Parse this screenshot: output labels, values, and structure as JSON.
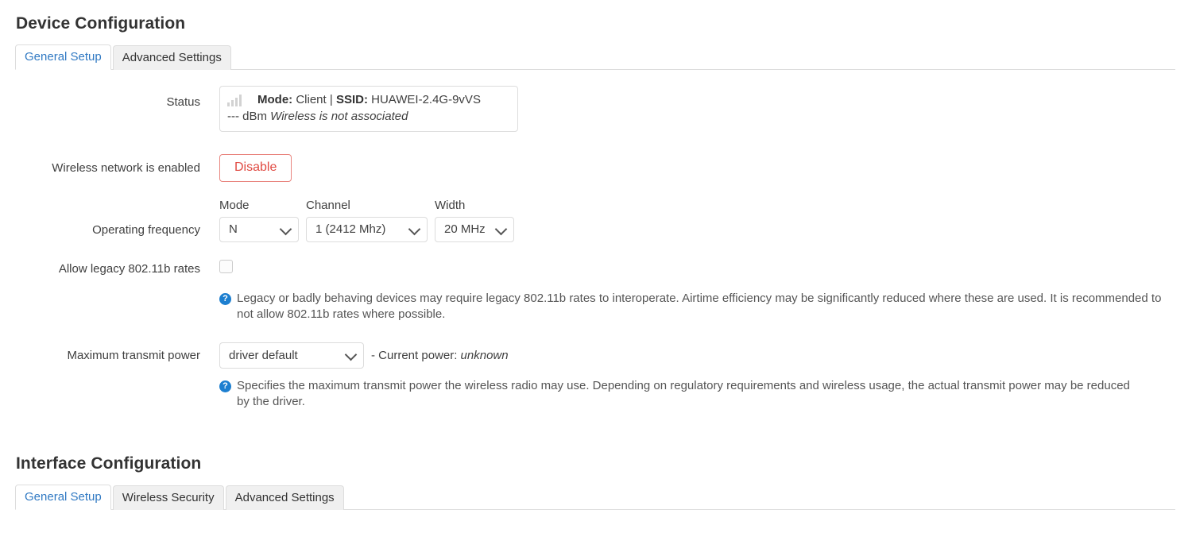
{
  "device_section": {
    "title": "Device Configuration",
    "tabs": [
      {
        "label": "General Setup",
        "active": true
      },
      {
        "label": "Advanced Settings",
        "active": false
      }
    ],
    "rows": {
      "status": {
        "label": "Status",
        "icon": "signal-bars-icon",
        "mode_key": "Mode:",
        "mode_value": "Client",
        "separator": "|",
        "ssid_key": "SSID:",
        "ssid_value": "HUAWEI-2.4G-9vVS",
        "dbm": "--- dBm",
        "note": "Wireless is not associated"
      },
      "wireless_enabled": {
        "label": "Wireless network is enabled",
        "button_label": "Disable",
        "button_color": "#e04a42",
        "button_border_color": "#e9857f"
      },
      "operating_frequency": {
        "label": "Operating frequency",
        "mode": {
          "sub_label": "Mode",
          "value": "N"
        },
        "channel": {
          "sub_label": "Channel",
          "value": "1 (2412 Mhz)"
        },
        "width": {
          "sub_label": "Width",
          "value": "20 MHz"
        }
      },
      "legacy_rates": {
        "label": "Allow legacy 802.11b rates",
        "checked": false,
        "help_icon": "question-mark-icon",
        "help": "Legacy or badly behaving devices may require legacy 802.11b rates to interoperate. Airtime efficiency may be significantly reduced where these are used. It is recommended to not allow 802.11b rates where possible."
      },
      "max_transmit_power": {
        "label": "Maximum transmit power",
        "value": "driver default",
        "current_prefix": "- Current power:",
        "current_value": "unknown",
        "help_icon": "question-mark-icon",
        "help": "Specifies the maximum transmit power the wireless radio may use. Depending on regulatory requirements and wireless usage, the actual transmit power may be reduced by the driver."
      }
    }
  },
  "interface_section": {
    "title": "Interface Configuration",
    "tabs": [
      {
        "label": "General Setup",
        "active": true
      },
      {
        "label": "Wireless Security",
        "active": false
      },
      {
        "label": "Advanced Settings",
        "active": false
      }
    ]
  },
  "theme": {
    "accent": "#3079c3",
    "help_icon_bg": "#1d7fd0",
    "danger": "#e04a42",
    "border": "#dddddd"
  }
}
